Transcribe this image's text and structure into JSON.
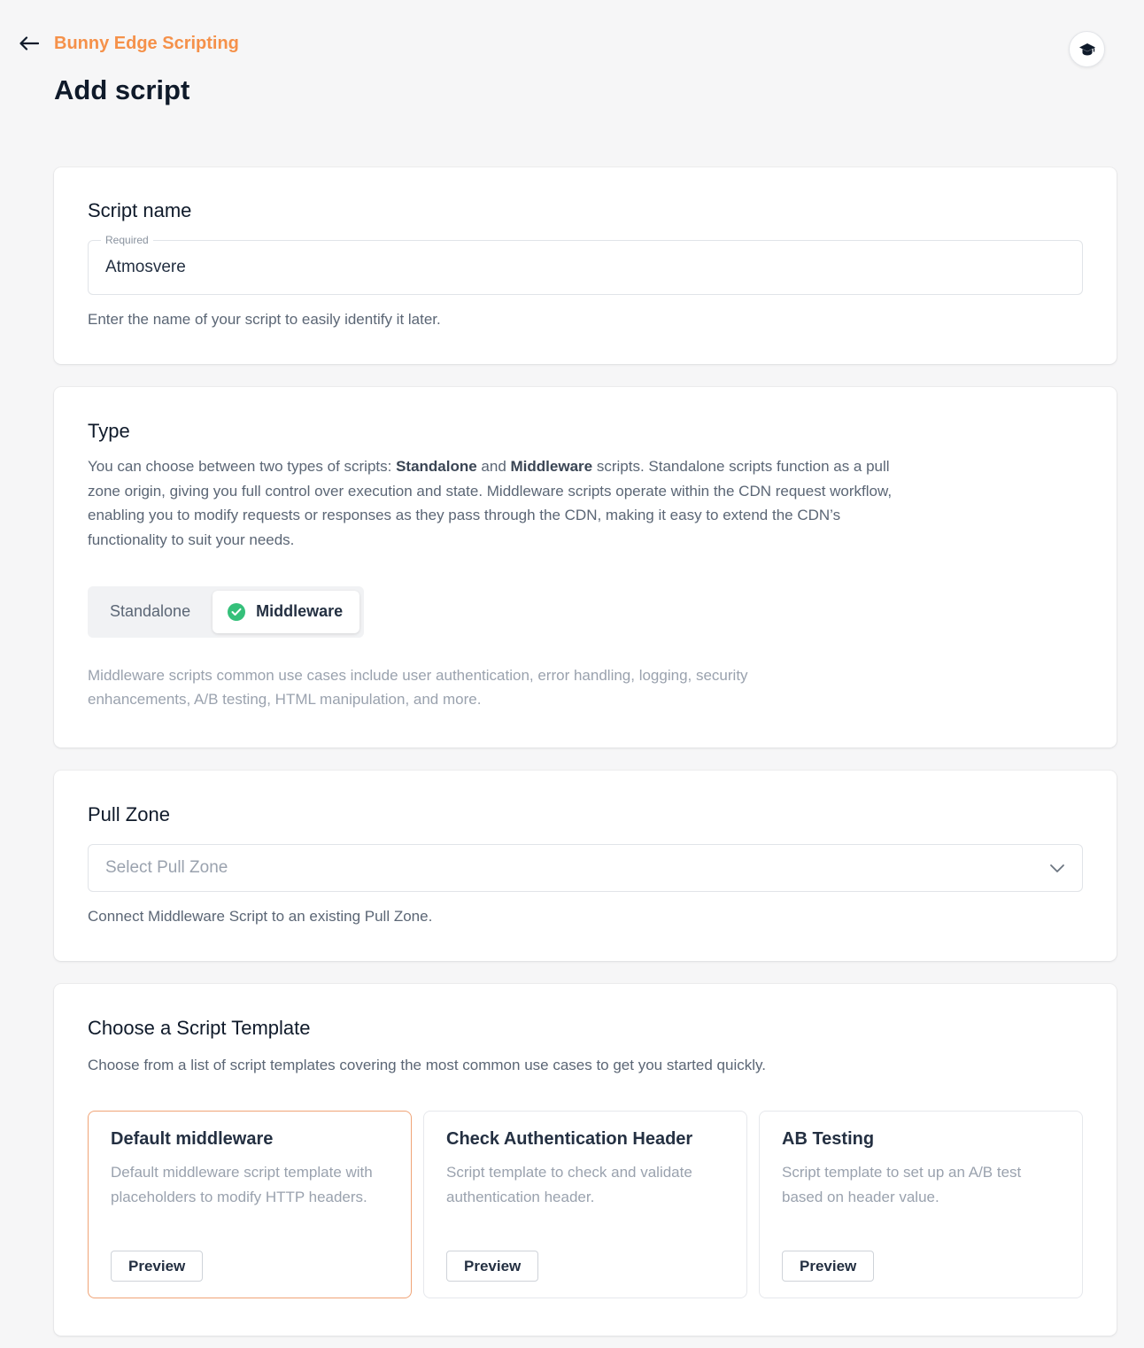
{
  "header": {
    "breadcrumb": "Bunny Edge Scripting",
    "title": "Add script"
  },
  "script_name": {
    "title": "Script name",
    "legend": "Required",
    "value": "Atmosvere",
    "hint": "Enter the name of your script to easily identify it later."
  },
  "type": {
    "title": "Type",
    "desc_prefix": "You can choose between two types of scripts: ",
    "standalone_bold": "Standalone",
    "and": " and ",
    "middleware_bold": "Middleware",
    "desc_suffix": " scripts. Standalone scripts function as a pull zone origin, giving you full control over execution and state. Middleware scripts operate within the CDN request workflow, enabling you to modify requests or responses as they pass through the CDN, making it easy to extend the CDN’s functionality to suit your needs.",
    "options": [
      "Standalone",
      "Middleware"
    ],
    "selected": "Middleware",
    "note": "Middleware scripts common use cases include user authentication, error handling, logging, security enhancements, A/B testing, HTML manipulation, and more."
  },
  "pull_zone": {
    "title": "Pull Zone",
    "placeholder": "Select Pull Zone",
    "hint": "Connect Middleware Script to an existing Pull Zone."
  },
  "templates": {
    "title": "Choose a Script Template",
    "hint": "Choose from a list of script templates covering the most common use cases to get you started quickly.",
    "items": [
      {
        "name": "Default middleware",
        "desc": "Default middleware script template with placeholders to modify HTTP headers.",
        "button": "Preview"
      },
      {
        "name": "Check Authentication Header",
        "desc": "Script template to check and validate authentication header.",
        "button": "Preview"
      },
      {
        "name": "AB Testing",
        "desc": "Script template to set up an A/B test based on header value.",
        "button": "Preview"
      }
    ]
  },
  "colors": {
    "accent": "#f5914a",
    "success": "#35c07a",
    "background": "#f6f6f7"
  },
  "icons": {
    "back": "arrow-left-icon",
    "academy": "graduation-cap-icon",
    "check": "check-circle-icon",
    "chevron": "chevron-down-icon"
  }
}
